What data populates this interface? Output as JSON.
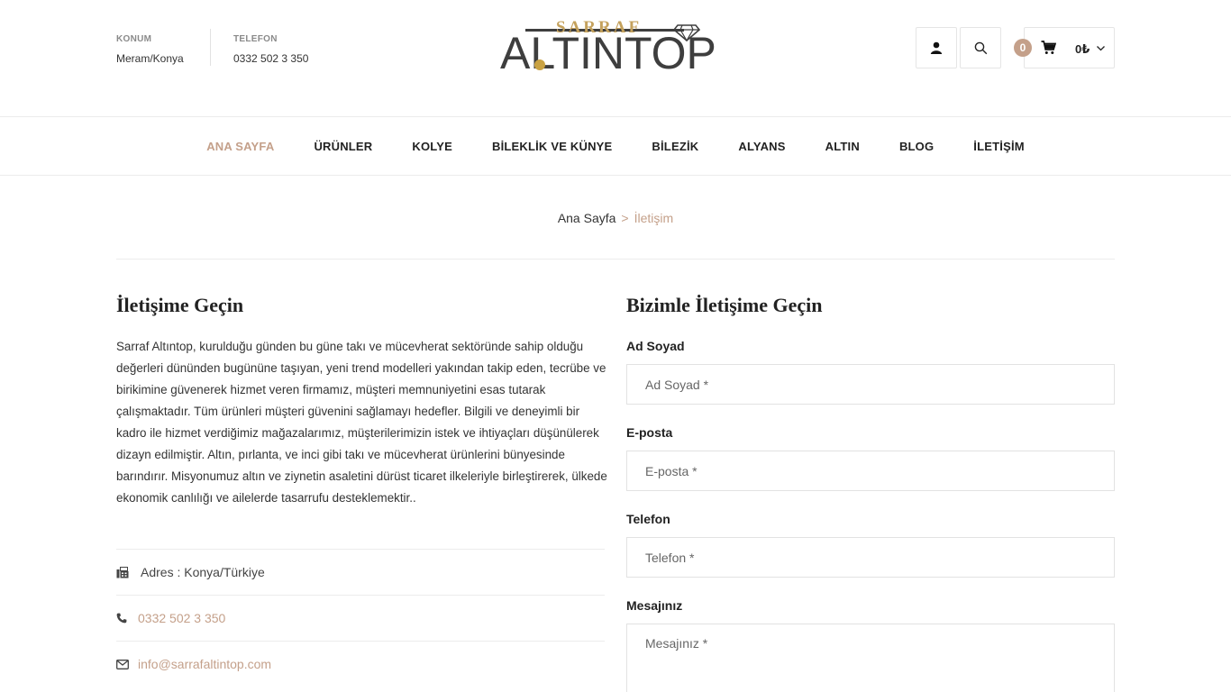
{
  "header": {
    "location_label": "KONUM",
    "location_value": "Meram/Konya",
    "phone_label": "TELEFON",
    "phone_value": "0332 502 3 350",
    "logo_top": "SARRAF",
    "logo_main": "ALTINTOP",
    "cart_count": "0",
    "cart_total": "0₺",
    "icons": [
      "user-icon",
      "search-icon",
      "cart-icon",
      "chevron-down-icon"
    ]
  },
  "nav": {
    "items": [
      {
        "label": "ANA SAYFA",
        "active": true
      },
      {
        "label": "ÜRÜNLER"
      },
      {
        "label": "KOLYE"
      },
      {
        "label": "BİLEKLİK VE KÜNYE"
      },
      {
        "label": "BİLEZİK"
      },
      {
        "label": "ALYANS"
      },
      {
        "label": "ALTIN"
      },
      {
        "label": "BLOG"
      },
      {
        "label": "İLETİŞİM"
      }
    ]
  },
  "breadcrumb": {
    "home": "Ana Sayfa",
    "separator": ">",
    "current": "İletişim"
  },
  "contact": {
    "title": "İletişime Geçin",
    "text": "Sarraf Altıntop, kurulduğu günden bu güne takı ve mücevherat sektöründe sahip olduğu değerleri dününden bugününe taşıyan, yeni trend modelleri yakından takip eden, tecrübe ve birikimine güvenerek hizmet veren firmamız, müşteri memnuniyetini esas tutarak çalışmaktadır. Tüm ürünleri müşteri güvenini sağlamayı hedefler. Bilgili ve deneyimli bir kadro ile hizmet verdiğimiz mağazalarımız, müşterilerimizin istek ve ihtiyaçları düşünülerek dizayn edilmiştir. Altın, pırlanta, ve inci gibi takı ve mücevherat ürünlerini bünyesinde barındırır. Misyonumuz altın ve ziynetin asaletini dürüst ticaret ilkeleriyle birleştirerek, ülkede ekonomik canlılığı ve ailelerde tasarrufu desteklemektir..",
    "address": "Adres : Konya/Türkiye",
    "phone": "0332 502 3 350",
    "email": "info@sarrafaltintop.com"
  },
  "form": {
    "title": "Bizimle İletişime Geçin",
    "name_label": "Ad Soyad",
    "name_placeholder": "Ad Soyad *",
    "email_label": "E-posta",
    "email_placeholder": "E-posta *",
    "phone_label": "Telefon",
    "phone_placeholder": "Telefon *",
    "message_label": "Mesajınız",
    "message_placeholder": "Mesajınız *"
  },
  "colors": {
    "accent": "#c4a08a",
    "gold": "#c9a243"
  }
}
